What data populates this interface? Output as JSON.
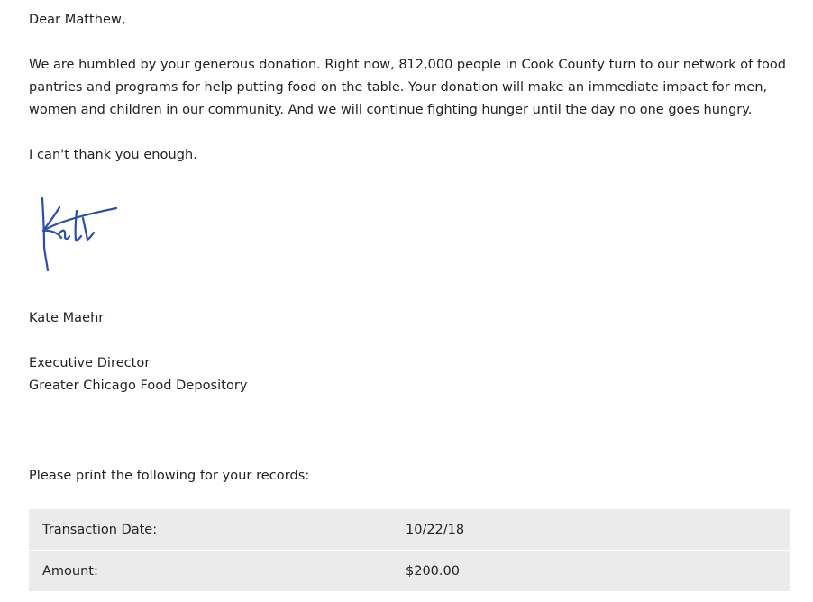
{
  "letter": {
    "salutation": "Dear Matthew,",
    "body_lines": [
      "We are humbled by your generous donation. Right now, 812,000 people in Cook County turn to our network of food",
      "pantries and programs for help putting food on the table. Your donation will make an immediate impact for men,",
      "women and children in our community. And we will continue fighting hunger until the day no one goes hungry."
    ],
    "thanks": "I can't thank you enough.",
    "signature_text": "Kate",
    "signer_name": "Kate Maehr",
    "signer_title": "Executive Director",
    "signer_org": "Greater Chicago Food Depository",
    "records_note": "Please print the following for your records:"
  },
  "records": {
    "transaction_date_label": "Transaction Date:",
    "transaction_date_value": "10/22/18",
    "amount_label": "Amount:",
    "amount_value": "$200.00"
  },
  "colors": {
    "text": "#222222",
    "signature_ink": "#2b4fa8",
    "table_background": "#ebebeb"
  }
}
